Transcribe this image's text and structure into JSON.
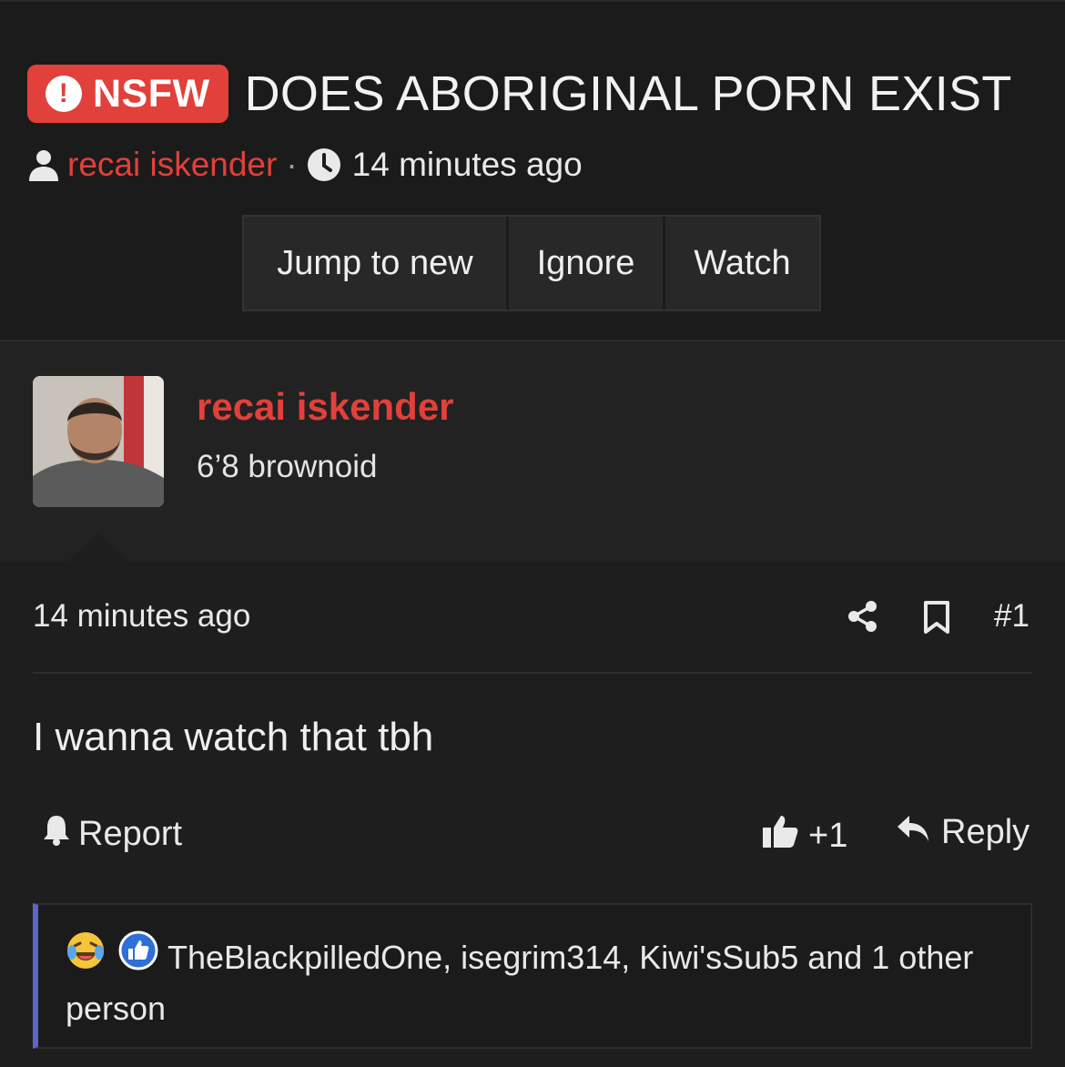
{
  "header": {
    "nsfw_label": "NSFW",
    "title": "DOES ABORIGINAL PORN EXIST",
    "author": "recai iskender",
    "separator": "·",
    "time": "14 minutes ago",
    "buttons": {
      "jump": "Jump to new",
      "ignore": "Ignore",
      "watch": "Watch"
    }
  },
  "post": {
    "username": "recai iskender",
    "user_title": "6’8 brownoid",
    "time": "14 minutes ago",
    "number": "#1",
    "message": "I wanna watch that tbh",
    "actions": {
      "report": "Report",
      "vote_count": "+1",
      "reply": "Reply"
    },
    "reactions": {
      "text": "TheBlackpilledOne, isegrim314, Kiwi'sSub5 and 1 other person",
      "icons": [
        "laughing-crying-emoji-icon",
        "thumbs-up-icon"
      ]
    }
  },
  "colors": {
    "accent_red": "#e2403a",
    "background": "#1b1b1b",
    "post_background": "#222222",
    "reaction_border": "#5c66c9"
  }
}
